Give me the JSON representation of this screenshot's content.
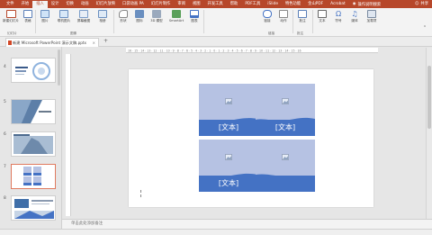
{
  "ribbon_tabs": [
    "文件",
    "开始",
    "插入",
    "设计",
    "切换",
    "动画",
    "幻灯片放映",
    "口袋动画 PA",
    "幻灯片制作",
    "审阅",
    "视图",
    "开发工具",
    "帮助",
    "PDF工具",
    "iSlide",
    "特色功能",
    "金山PDF",
    "Acrobat"
  ],
  "active_tab_index": 2,
  "tell_me": "操作说明搜索",
  "share_label": "共享",
  "groups": {
    "slides": "幻灯片",
    "images": "图像",
    "links": "链接",
    "comments": "批注"
  },
  "buttons": {
    "new_slide": "新建幻灯片",
    "table": "表格",
    "pictures": "图片",
    "online_pictures": "联机图片",
    "screenshot": "屏幕截图",
    "photo_album": "相册",
    "shapes": "形状",
    "icons": "图标",
    "models_3d": "3D 模型",
    "smartart": "SmartArt",
    "chart": "图表",
    "link": "链接",
    "action": "动作",
    "comment": "批注",
    "text": "文本",
    "symbols": "符号",
    "media": "媒体",
    "addins": "加载项"
  },
  "doc_tab": "新建 Microsoft PowerPoint 演示文稿.pptx",
  "thumbnails": [
    {
      "num": "4"
    },
    {
      "num": "5"
    },
    {
      "num": "6"
    },
    {
      "num": "7"
    },
    {
      "num": "8"
    }
  ],
  "selected_thumbnail": "7",
  "ruler_text": "16 · 15 · 14 · 13 · 12 · 11 · 10 · 9 · 8 · 7 · 6 · 5 · 4 · 3 · 2 · 1 · 0 · 1 · 2 · 3 · 4 · 5 · 6 · 7 · 8 · 9 · 10 · 11 · 12 · 13 · 14 · 15 · 16",
  "slide": {
    "placeholders": [
      {
        "label": "[文本]"
      },
      {
        "label": "[文本]"
      },
      {
        "label": "[文本]"
      },
      {
        "label": ""
      }
    ]
  },
  "notes_placeholder": "单击此处添加备注",
  "colors": {
    "accent": "#b7472a",
    "tile_light": "#b6c2e3",
    "tile_dark": "#4472c4"
  }
}
